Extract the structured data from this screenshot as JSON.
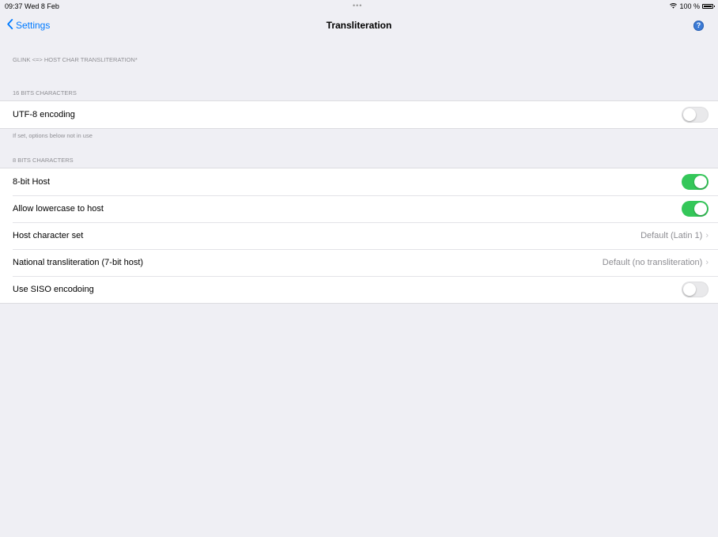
{
  "status_bar": {
    "time_date": "09:37  Wed 8 Feb",
    "dots": "•••",
    "battery_text": "100 %"
  },
  "nav": {
    "back_label": "Settings",
    "title": "Transliteration",
    "help_icon": "?"
  },
  "page_header": "GLINK <=> HOST CHAR TRANSLITERATION*",
  "sections": {
    "bits16": {
      "header": "16 BITS CHARACTERS",
      "rows": [
        {
          "label": "UTF-8 encoding",
          "toggle": false
        }
      ],
      "footer": "If set, options below not in use"
    },
    "bits8": {
      "header": "8 BITS CHARACTERS",
      "rows": [
        {
          "label": "8-bit Host",
          "toggle": true
        },
        {
          "label": "Allow lowercase to host",
          "toggle": true
        },
        {
          "label": "Host character set",
          "value": "Default (Latin 1)"
        },
        {
          "label": "National transliteration (7-bit host)",
          "value": "Default (no transliteration)"
        },
        {
          "label": "Use SISO encodoing",
          "toggle": false
        }
      ]
    }
  },
  "colors": {
    "accent": "#007aff",
    "toggle_on": "#34c759",
    "background": "#efeff4"
  }
}
